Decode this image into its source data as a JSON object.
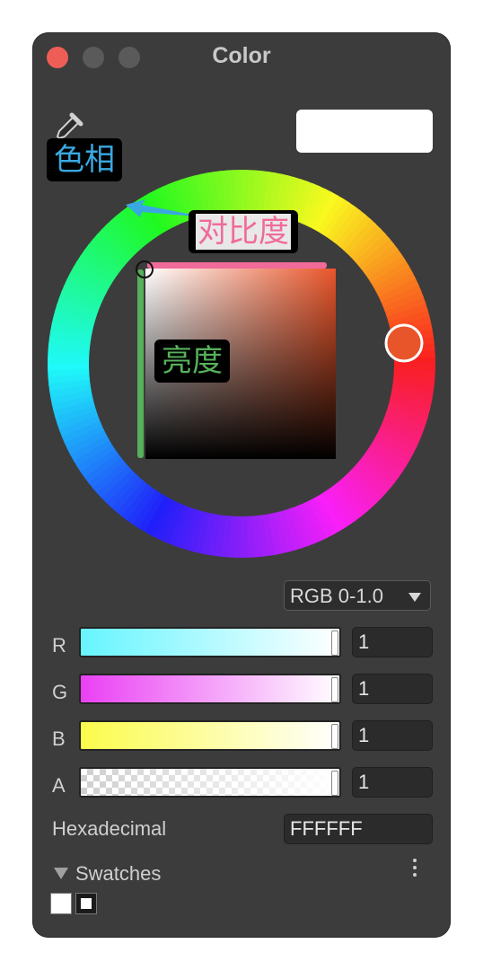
{
  "window": {
    "title": "Color"
  },
  "annotations": {
    "hue": "色相",
    "contrast": "对比度",
    "brightness": "亮度"
  },
  "preview": {
    "color": "#FFFFFF"
  },
  "mode_dropdown": {
    "selected": "RGB 0-1.0"
  },
  "channels": [
    {
      "label": "R",
      "value": "1",
      "color": "#66F5FF"
    },
    {
      "label": "G",
      "value": "1",
      "color": "#EA40F3"
    },
    {
      "label": "B",
      "value": "1",
      "color": "#FBFB4C"
    },
    {
      "label": "A",
      "value": "1",
      "color": "#FFFFFF"
    }
  ],
  "hex": {
    "label": "Hexadecimal",
    "value": "FFFFFF"
  },
  "swatches": {
    "label": "Swatches"
  },
  "icons": [
    "eyedropper-icon",
    "disclosure-triangle-icon",
    "more-vertical-icon"
  ]
}
